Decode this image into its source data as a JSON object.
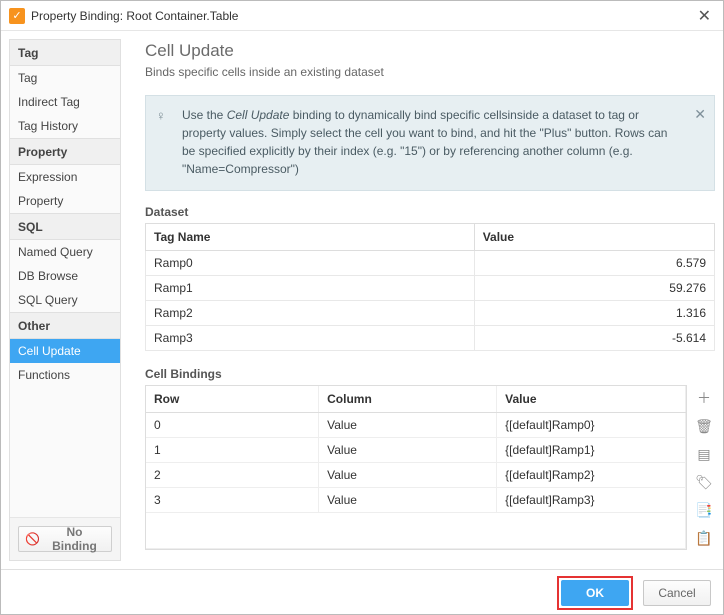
{
  "window": {
    "title": "Property Binding: Root Container.Table",
    "close_glyph": "✕"
  },
  "sidebar": {
    "groups": [
      {
        "label": "Tag",
        "items": [
          "Tag",
          "Indirect Tag",
          "Tag History"
        ]
      },
      {
        "label": "Property",
        "items": [
          "Expression",
          "Property"
        ]
      },
      {
        "label": "SQL",
        "items": [
          "Named Query",
          "DB Browse",
          "SQL Query"
        ]
      },
      {
        "label": "Other",
        "items": [
          "Cell Update",
          "Functions"
        ]
      }
    ],
    "selected": "Cell Update",
    "no_binding_label": "No Binding"
  },
  "content": {
    "title": "Cell Update",
    "subtitle": "Binds specific cells inside an existing dataset",
    "tip_prefix": "Use the ",
    "tip_em": "Cell Update",
    "tip_rest": " binding to dynamically bind specific cellsinside a dataset to tag or property values. Simply select the cell you want to bind, and hit the \"Plus\" button. Rows can be specified explicitly by their index (e.g. \"15\") or by referencing another column (e.g. \"Name=Compressor\")",
    "dataset_label": "Dataset",
    "dataset_headers": [
      "Tag Name",
      "Value"
    ],
    "dataset_rows": [
      {
        "name": "Ramp0",
        "value": "6.579"
      },
      {
        "name": "Ramp1",
        "value": "59.276"
      },
      {
        "name": "Ramp2",
        "value": "1.316"
      },
      {
        "name": "Ramp3",
        "value": "-5.614"
      }
    ],
    "bindings_label": "Cell Bindings",
    "bindings_headers": [
      "Row",
      "Column",
      "Value"
    ],
    "bindings_rows": [
      {
        "row": "0",
        "column": "Value",
        "value": "{[default]Ramp0}"
      },
      {
        "row": "1",
        "column": "Value",
        "value": "{[default]Ramp1}"
      },
      {
        "row": "2",
        "column": "Value",
        "value": "{[default]Ramp2}"
      },
      {
        "row": "3",
        "column": "Value",
        "value": "{[default]Ramp3}"
      }
    ]
  },
  "footer": {
    "ok": "OK",
    "cancel": "Cancel"
  }
}
